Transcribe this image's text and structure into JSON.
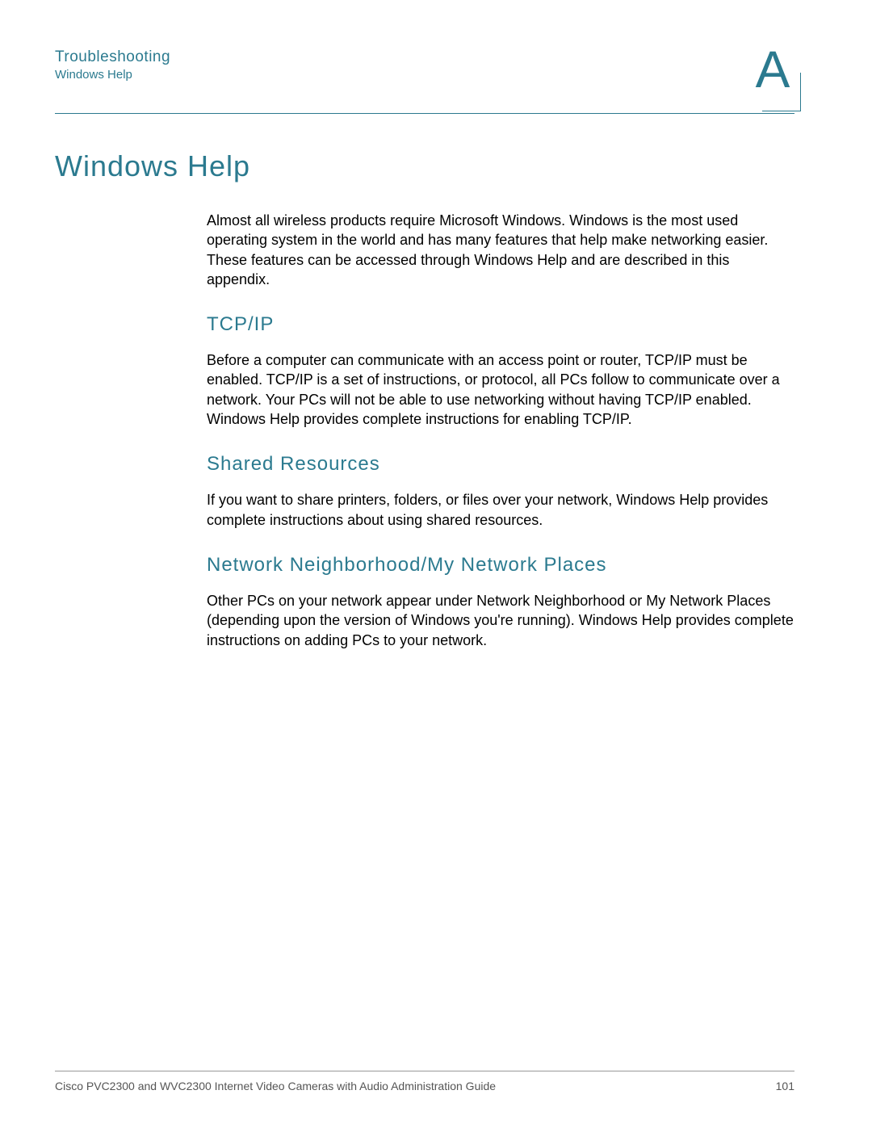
{
  "header": {
    "chapter": "Troubleshooting",
    "section": "Windows Help",
    "appendix_letter": "A"
  },
  "main": {
    "title": "Windows Help",
    "intro": "Almost all wireless products require Microsoft Windows. Windows is the most used operating system in the world and has many features that help make networking easier. These features can be accessed through Windows Help and are described in this appendix.",
    "sections": [
      {
        "heading": "TCP/IP",
        "body": "Before a computer can communicate with an access point or router, TCP/IP must be enabled. TCP/IP is a set of instructions, or protocol, all PCs follow to communicate over a network. Your PCs will not be able to use networking without having TCP/IP enabled. Windows Help provides complete instructions for enabling TCP/IP."
      },
      {
        "heading": "Shared Resources",
        "body": "If you want to share printers, folders, or files over your network, Windows Help provides complete instructions about using shared resources."
      },
      {
        "heading": "Network Neighborhood/My Network Places",
        "body": "Other PCs on your network appear under Network Neighborhood or My Network Places (depending upon the version of Windows you're running). Windows Help provides complete instructions on adding PCs to your network."
      }
    ]
  },
  "footer": {
    "guide": "Cisco PVC2300 and WVC2300 Internet Video Cameras with Audio Administration Guide",
    "page": "101"
  }
}
